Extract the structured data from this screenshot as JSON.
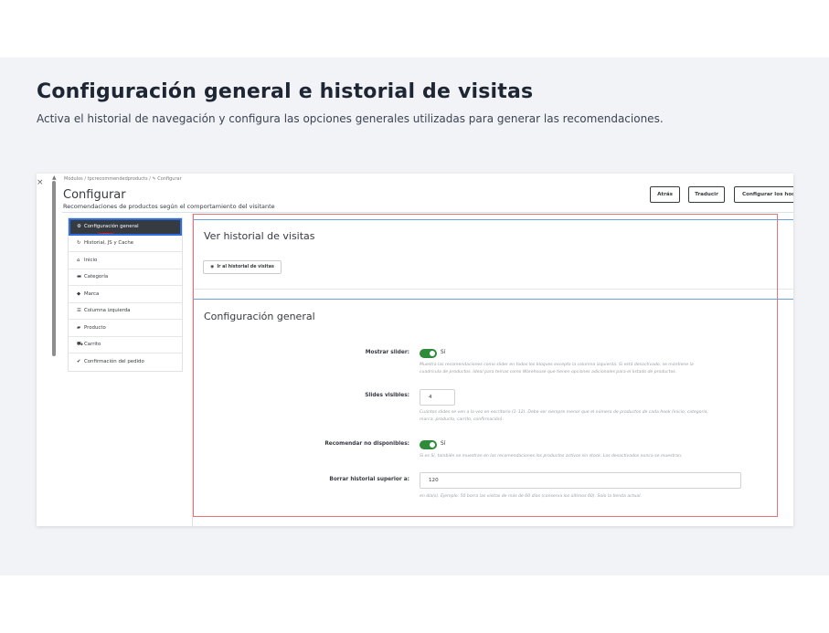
{
  "hero": {
    "title": "Configuración general e historial de visitas",
    "subtitle": "Activa el historial de navegación y configura las opciones generales utilizadas para generar las recomendaciones."
  },
  "window": {
    "close_glyph": "×",
    "scroll_up_glyph": "▲"
  },
  "breadcrumb": "Módulos  /  tpcrecommendedproducts  /  ✎ Configurar",
  "page": {
    "title": "Configurar",
    "subtitle": "Recomendaciones de productos según el comportamiento del visitante"
  },
  "toolbar": {
    "back_label": "Atrás",
    "translate_label": "Traducir",
    "hooks_label": "Configurar los hooks"
  },
  "sidebar": {
    "items": [
      {
        "label": "Configuración general",
        "icon": "cogs-icon",
        "glyph": "⚙"
      },
      {
        "label": "Historial, JS y Cache",
        "icon": "refresh-icon",
        "glyph": "↻"
      },
      {
        "label": "Inicio",
        "icon": "home-icon",
        "glyph": "⌂"
      },
      {
        "label": "Categoría",
        "icon": "folder-icon",
        "glyph": "▬"
      },
      {
        "label": "Marca",
        "icon": "tag-icon",
        "glyph": "◆"
      },
      {
        "label": "Columna izquierda",
        "icon": "columns-icon",
        "glyph": "☰"
      },
      {
        "label": "Producto",
        "icon": "book-icon",
        "glyph": "▰"
      },
      {
        "label": "Carrito",
        "icon": "cart-icon",
        "glyph": "⛟"
      },
      {
        "label": "Confirmación del pedido",
        "icon": "check-icon",
        "glyph": "✔"
      }
    ],
    "active_index": 0
  },
  "history": {
    "title": "Ver historial de visitas",
    "button_label": "Ir al historial de visitas",
    "button_icon": "eye-icon",
    "button_glyph": "◉"
  },
  "general": {
    "title": "Configuración general",
    "fields": {
      "slider": {
        "label": "Mostrar slider:",
        "value": "Sí",
        "help1": "Muestra las recomendaciones como slider en todos los bloques excepto la columna izquierda. Si está desactivado, se mantiene la",
        "help2": "cuadrícula de productos. Ideal para temas como Warehouse que tienen opciones adicionales para el listado de productos."
      },
      "slides": {
        "label": "Slides visibles:",
        "value": "4",
        "help1": "Cuántos slides se ven a la vez en escritorio (1–12). Debe ser siempre menor que el número de productos de cada hook (inicio, categoría,",
        "help2": "marca, producto, carrito, confirmación)."
      },
      "unavailable": {
        "label": "Recomendar no disponibles:",
        "value": "Sí",
        "help1": "Si es Sí, también se muestran en las recomendaciones los productos actívos sin stock. Los desactivados nunca se muestran."
      },
      "history_days": {
        "label": "Borrar historial superior a:",
        "value": "120",
        "help1": "en día(s). Ejemplo: 50 borra las visitas de más de 60 días (conserva los últimos 60). Solo la tienda actual."
      }
    }
  },
  "colors": {
    "accent_blue": "#6aa1dd",
    "toggle_green": "#2e8b3a",
    "active_nav": "#363a41",
    "annotation_red": "#e57373"
  }
}
